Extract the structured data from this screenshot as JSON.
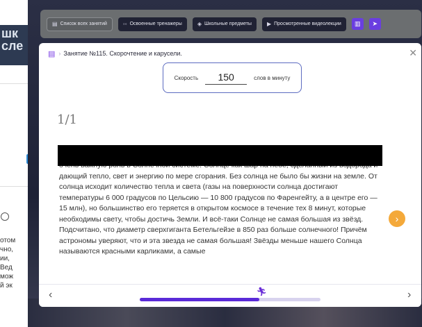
{
  "background_page": {
    "banner_lines": [
      "шк",
      "сле"
    ],
    "text_lines": [
      "отом",
      "чно,",
      "ии,",
      "Вед",
      "мож",
      "й эк"
    ]
  },
  "topbar": {
    "buttons": [
      {
        "icon": "list-icon",
        "label": "Список всех занятий",
        "style": "light"
      },
      {
        "icon": "glasses-icon",
        "label": "Освоенные тренажеры",
        "style": "dark"
      },
      {
        "icon": "school-icon",
        "label": "Школьные предметы",
        "style": "dark"
      },
      {
        "icon": "video-icon",
        "label": "Просмотренные видеолекции",
        "style": "dark"
      }
    ],
    "extra_icons": [
      "chart-icon",
      "telegram-icon"
    ]
  },
  "modal": {
    "breadcrumb_separator": "›",
    "title": "Занятие №115. Скорочтение и карусели.",
    "speed": {
      "label": "Скорость",
      "value": "150",
      "unit": "слов в минуту"
    },
    "page_counter": "1/1",
    "reading_text": "очень важную роль в Солнечной системе. Солнце как шар на небе, сделанный из водорода и дающий тепло, свет и энергию по мере сгорания. Без солнца не было бы жизни на земле. От солнца исходит количество тепла и света (газы на поверхности солнца достигают температуры 6 000 градусов по Цельсию — 10 800 градусов по Фаренгейту, а в центре его — 15 млн), но большинство его теряется в открытом космосе в течение тех 8 минут, которые необходимы свету, чтобы достичь Земли. И всё-таки Солнце не самая большая из звёзд. Подсчитано, что диаметр сверхгиганта Бетельгейзе в 850 раз больше солнечного! Причём астрономы уверяют, что и эта звезда не самая большая! Звёзды меньше нашего Солнца называются красными карликами, а самые",
    "progress_fraction": 0.66
  },
  "colors": {
    "accent": "#5a2ad8",
    "orange": "#f4a93a",
    "topbar": "#6b6e70"
  }
}
